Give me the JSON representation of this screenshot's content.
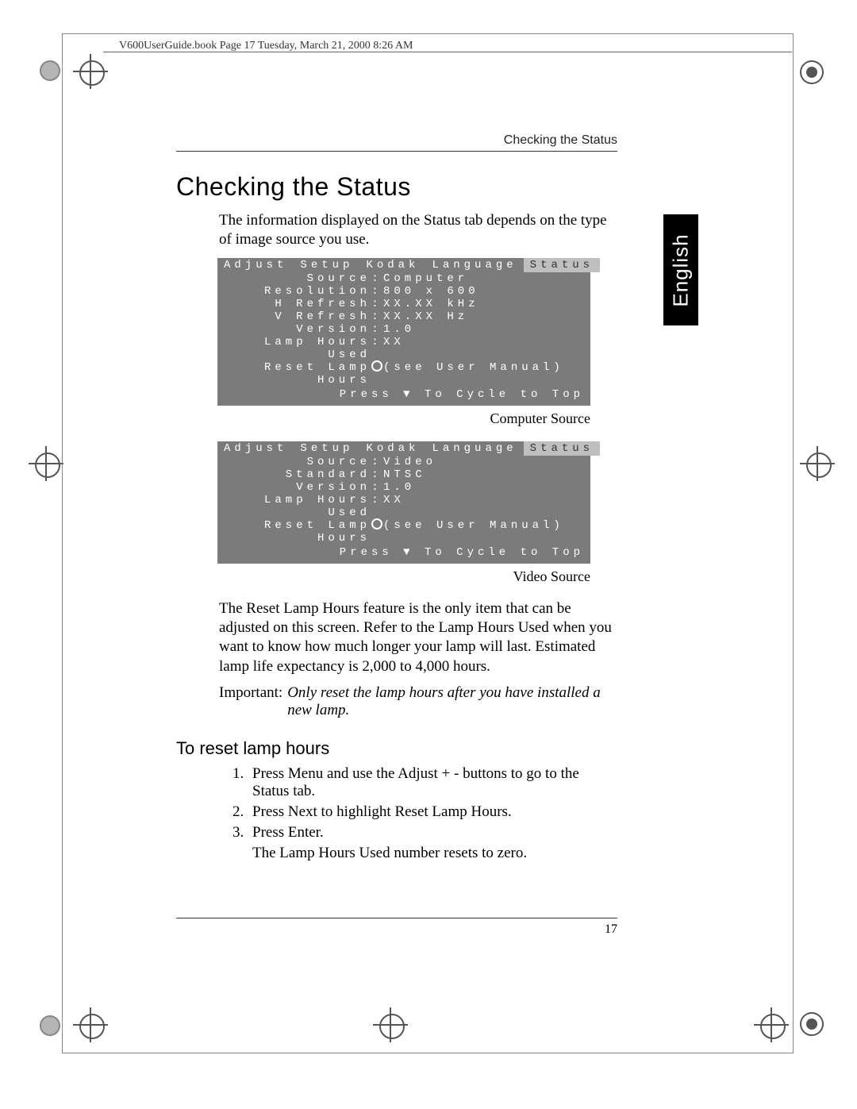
{
  "header": {
    "stamp": "V600UserGuide.book  Page 17  Tuesday, March 21, 2000  8:26 AM"
  },
  "running_head": "Checking the Status",
  "title": "Checking the Status",
  "intro": "The information displayed on the Status tab depends on the type of image source you use.",
  "osd_tabs": [
    "Adjust",
    "Setup",
    "Kodak",
    "Language",
    "Status"
  ],
  "osd_computer": {
    "rows": [
      {
        "label": "Source",
        "value": "Computer"
      },
      {
        "label": "Resolution",
        "value": "800 x 600"
      },
      {
        "label": "H Refresh",
        "value": "XX.XX kHz"
      },
      {
        "label": "V Refresh",
        "value": "XX.XX Hz"
      },
      {
        "label": "Version",
        "value": "1.0"
      },
      {
        "label": "Lamp Hours Used",
        "value": "XX"
      },
      {
        "label": "Reset Lamp Hours",
        "value": "(see User Manual)",
        "knob": true
      }
    ],
    "footer": "Press ▼ To Cycle to Top",
    "caption": "Computer Source"
  },
  "osd_video": {
    "rows": [
      {
        "label": "Source",
        "value": "Video"
      },
      {
        "label": "Standard",
        "value": "NTSC"
      },
      {
        "label": "Version",
        "value": "1.0"
      },
      {
        "label": "Lamp Hours Used",
        "value": "XX"
      },
      {
        "label": "Reset Lamp Hours",
        "value": "(see User Manual)",
        "knob": true
      }
    ],
    "footer": "Press ▼ To Cycle to Top",
    "caption": "Video Source"
  },
  "para2": "The Reset Lamp Hours feature is the only item that can be adjusted on this screen. Refer to the Lamp Hours Used when you want to know how much longer your lamp will last. Estimated lamp life expectancy is 2,000 to 4,000 hours.",
  "important": {
    "label": "Important:",
    "text": "Only reset the lamp hours after you have installed a new lamp."
  },
  "subtitle": "To reset lamp hours",
  "steps": [
    "Press Menu and use the Adjust + - buttons to go to the Status tab.",
    "Press Next to highlight Reset Lamp Hours.",
    "Press Enter."
  ],
  "step_result": "The Lamp Hours Used number resets to zero.",
  "language_tab": "English",
  "page_number": "17"
}
